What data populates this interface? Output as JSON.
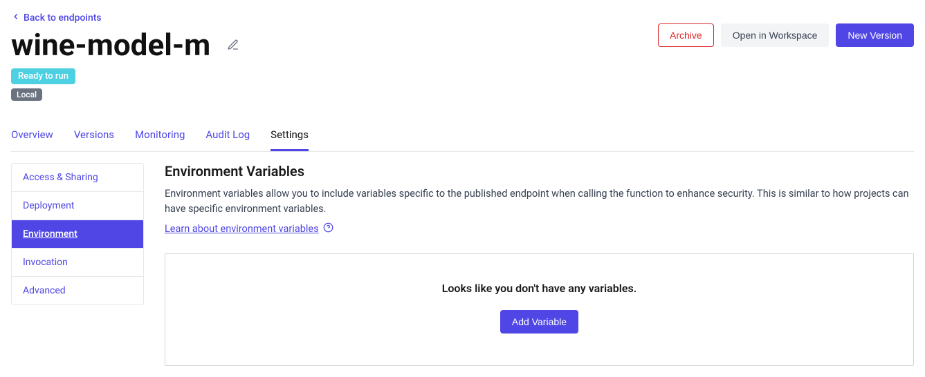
{
  "back_link": "Back to endpoints",
  "title": "wine-model-m",
  "badges": {
    "status": "Ready to run",
    "scope": "Local"
  },
  "actions": {
    "archive": "Archive",
    "workspace": "Open in Workspace",
    "new_version": "New Version"
  },
  "tabs": [
    {
      "label": "Overview",
      "active": false
    },
    {
      "label": "Versions",
      "active": false
    },
    {
      "label": "Monitoring",
      "active": false
    },
    {
      "label": "Audit Log",
      "active": false
    },
    {
      "label": "Settings",
      "active": true
    }
  ],
  "side_nav": [
    {
      "label": "Access & Sharing",
      "active": false
    },
    {
      "label": "Deployment",
      "active": false
    },
    {
      "label": "Environment",
      "active": true
    },
    {
      "label": "Invocation",
      "active": false
    },
    {
      "label": "Advanced",
      "active": false
    }
  ],
  "section": {
    "title": "Environment Variables",
    "description": "Environment variables allow you to include variables specific to the published endpoint when calling the function to enhance security. This is similar to how projects can have specific environment variables.",
    "learn_link": "Learn about environment variables",
    "empty_message": "Looks like you don't have any variables.",
    "add_button": "Add Variable"
  }
}
